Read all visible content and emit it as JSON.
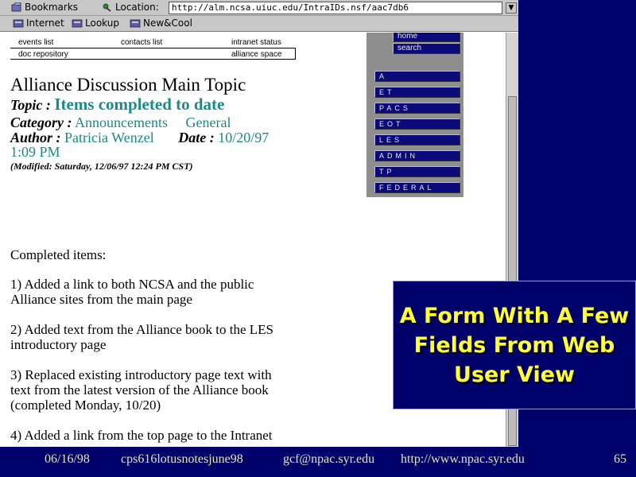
{
  "toolbar": {
    "bookmarks_label": "Bookmarks",
    "location_label": "Location:",
    "url": "http://alm.ncsa.uiuc.edu/IntraIDs.nsf/aac7db6",
    "personal": [
      "Internet",
      "Lookup",
      "New&Cool"
    ]
  },
  "top_nav": {
    "row1": [
      "events list",
      "contacts list",
      "intranet status"
    ],
    "row2": [
      "doc repository",
      "alliance space"
    ]
  },
  "side_nav": {
    "top": [
      "home",
      "search"
    ],
    "main": [
      "A",
      "ET",
      "PACS",
      "EOT",
      "LES",
      "ADMIN",
      "TP",
      "FEDERAL"
    ]
  },
  "document": {
    "main_title": "Alliance Discussion Main Topic",
    "topic_label": "Topic :",
    "topic_value": "Items completed to date",
    "category_label": "Category :",
    "category_value": "Announcements",
    "category_value2": "General",
    "author_label": "Author :",
    "author_value": "Patricia Wenzel",
    "date_label": "Date :",
    "date_value": "10/20/97",
    "time_value": "1:09 PM",
    "modified": "(Modified: Saturday, 12/06/97 12:24 PM CST)",
    "body": [
      "Completed items:",
      "1) Added a link to both NCSA and the public",
      "Alliance sites from the main page",
      "2) Added text from the Alliance book to the LES",
      "introductory page",
      "3) Replaced existing introductory page text with",
      "text from the latest version of the Alliance book",
      "(completed Monday, 10/20)",
      "4) Added a link from the top page to the Intranet"
    ]
  },
  "callout": "A Form With A Few Fields From Web User View",
  "footer": {
    "date": "06/16/98",
    "file": "cps616lotusnotesjune98",
    "email": "gcf@npac.syr.edu",
    "url": "http://www.npac.syr.edu",
    "page": "65"
  }
}
